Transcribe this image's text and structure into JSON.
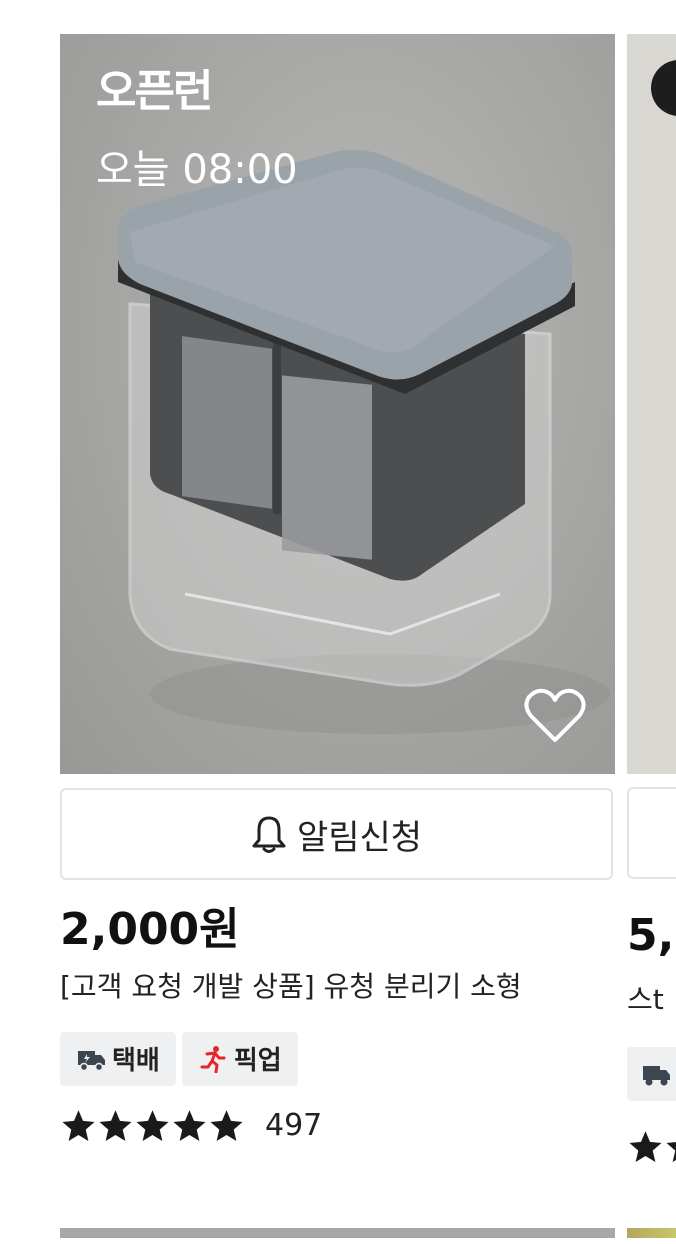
{
  "product": {
    "open_run_logo": "오픈런",
    "open_time": "오늘 08:00",
    "notify_label": "알림신청",
    "price": "2,000원",
    "title": "[고객 요청 개발 상품] 유청 분리기 소형",
    "badges": [
      {
        "label": "택배",
        "icon": "delivery-truck-icon"
      },
      {
        "label": "픽업",
        "icon": "running-person-icon"
      }
    ],
    "rating": 5,
    "review_count": "497"
  },
  "next_product": {
    "price_partial": "5,",
    "title_partial": "스t"
  },
  "colors": {
    "pickup_icon": "#e8242b",
    "badge_bg": "#eef0f2",
    "star": "#1a1a1a"
  }
}
